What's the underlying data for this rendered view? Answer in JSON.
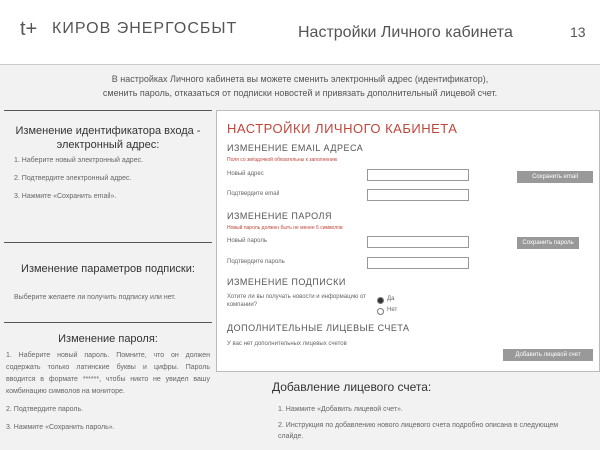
{
  "header": {
    "logo_mark": "t+",
    "brand": "КИРОВ ЭНЕРГОСБЫТ",
    "title": "Настройки Личного кабинета",
    "page_number": "13"
  },
  "intro_line1": "В настройках Личного кабинета вы можете сменить электронный адрес (идентификатор),",
  "intro_line2": "сменить пароль, отказаться от подписки новостей и привязать дополнительный лицевой счет.",
  "left": {
    "change_id_title": "Изменение идентификатора входа - электронный адрес:",
    "change_id_steps": [
      "1. Наберите новый электронный адрес.",
      "2. Подтвердите электронный адрес.",
      "3. Нажмите «Сохранить email»."
    ],
    "subscription_title": "Изменение параметров подписки:",
    "subscription_text": "Выберите желаете ли получить подписку или нет.",
    "password_title": "Изменение пароля:",
    "password_step1": "1. Наберите новый пароль. Помните, что он должен содержать только латинские буквы и цифры. Пароль вводится в формате ******, чтобы никто не увидел вашу комбинацию символов на мониторе.",
    "password_step2": "2. Подтвердите пароль.",
    "password_step3": "3. Нажмите «Сохранить пароль»."
  },
  "panel": {
    "title": "НАСТРОЙКИ ЛИЧНОГО КАБИНЕТА",
    "email_section": "ИЗМЕНЕНИЕ EMAIL АДРЕСА",
    "email_note": "Поля со звёздочкой обязательны к заполнению",
    "email_label": "Новый адрес",
    "email_confirm_label": "Подтвердите email",
    "save_email_button": "Сохранить email",
    "password_section": "ИЗМЕНЕНИЕ ПАРОЛЯ",
    "password_note": "Новый пароль должен быть не менее 6 символов",
    "password_label": "Новый пароль",
    "password_confirm_label": "Подтвердите пароль",
    "save_password_button": "Сохранить пароль",
    "subscription_section": "ИЗМЕНЕНИЕ ПОДПИСКИ",
    "subscription_question": "Хотите ли вы получать новости и информацию от компании?",
    "radio_yes": "Да",
    "radio_no": "Нет",
    "accounts_section": "ДОПОЛНИТЕЛЬНЫЕ ЛИЦЕВЫЕ СЧЕТА",
    "accounts_text": "У вас нет дополнительных лицевых счетов",
    "add_account_button": "Добавить лицевой счет"
  },
  "bottom": {
    "title": "Добавление лицевого счета:",
    "step1": "1. Нажмите «Добавить лицевой счет».",
    "step2": "2. Инструкция по добавлению нового лицевого счета подробно описана в следующем слайде."
  }
}
